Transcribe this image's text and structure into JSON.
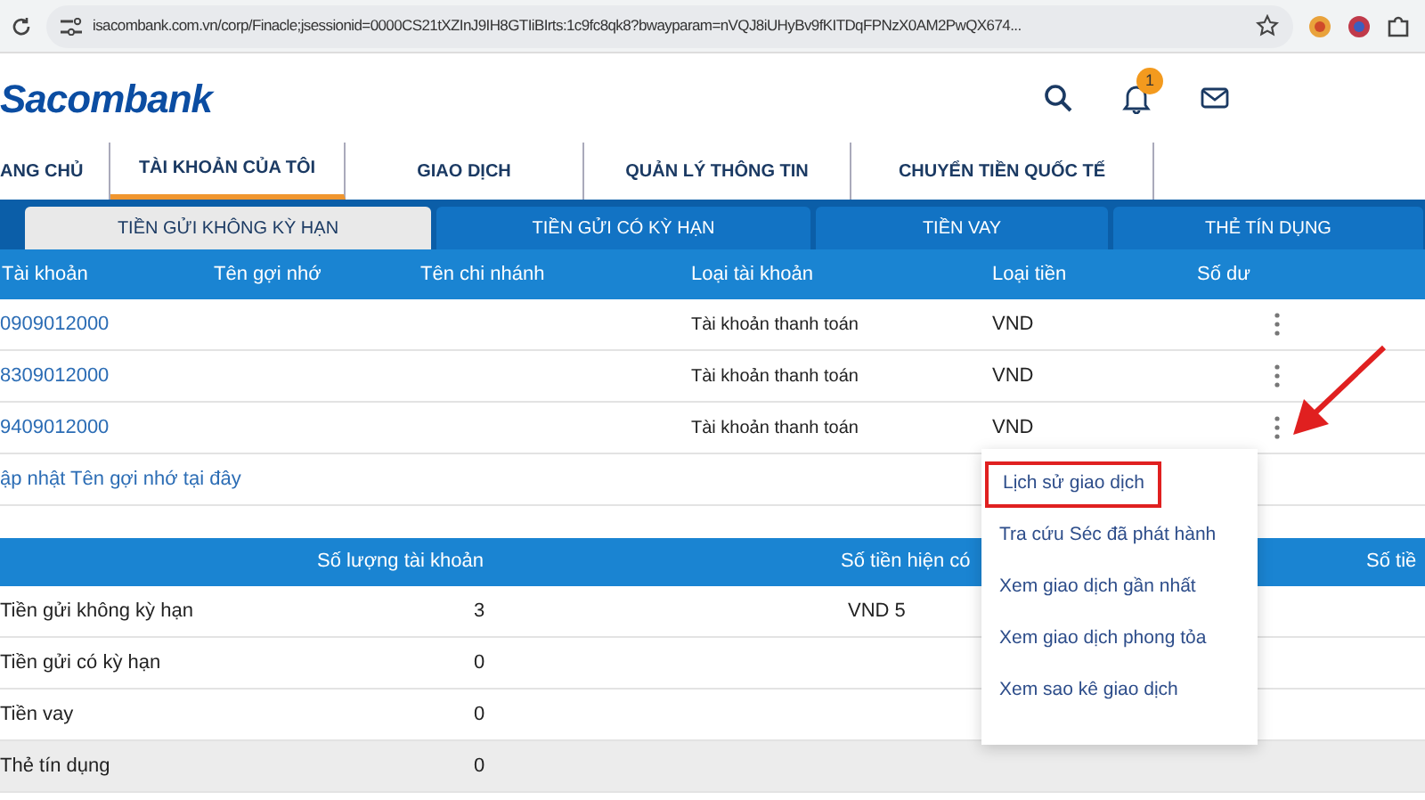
{
  "browser": {
    "url": "isacombank.com.vn/corp/Finacle;jsessionid=0000CS21tXZInJ9IH8GTIiBIrts:1c9fc8qk8?bwayparam=nVQJ8iUHyBv9fKITDqFPNzX0AM2PwQX674..."
  },
  "header": {
    "logo": "Sacombank",
    "notification_count": "1"
  },
  "nav": [
    {
      "label": "ANG CHỦ",
      "selected": false
    },
    {
      "label": "TÀI KHOẢN CỦA TÔI",
      "selected": true
    },
    {
      "label": "GIAO DỊCH",
      "selected": false
    },
    {
      "label": "QUẢN LÝ THÔNG TIN",
      "selected": false
    },
    {
      "label": "CHUYỂN TIỀN QUỐC TẾ",
      "selected": false
    }
  ],
  "tabs": [
    {
      "label": "TIỀN GỬI KHÔNG KỲ HẠN",
      "selected": true
    },
    {
      "label": "TIỀN GỬI CÓ KỲ HẠN",
      "selected": false
    },
    {
      "label": "TIỀN VAY",
      "selected": false
    },
    {
      "label": "THẺ TÍN DỤNG",
      "selected": false
    }
  ],
  "accounts": {
    "columns": [
      "Tài khoản",
      "Tên gợi nhớ",
      "Tên chi nhánh",
      "Loại tài khoản",
      "Loại tiền",
      "Số dư"
    ],
    "rows": [
      {
        "account": "0909012000",
        "type": "Tài khoản thanh toán",
        "currency": "VND"
      },
      {
        "account": "8309012000",
        "type": "Tài khoản thanh toán",
        "currency": "VND"
      },
      {
        "account": "9409012000",
        "type": "Tài khoản thanh toán",
        "currency": "VND"
      }
    ],
    "update_link": "ập nhật Tên gợi nhớ tại đây"
  },
  "menu": {
    "items": [
      {
        "label": "Lịch sử giao dịch",
        "highlighted": true
      },
      {
        "label": "Tra cứu Séc đã phát hành",
        "highlighted": false
      },
      {
        "label": "Xem giao dịch gần nhất",
        "highlighted": false
      },
      {
        "label": "Xem giao dịch phong tỏa",
        "highlighted": false
      },
      {
        "label": "Xem sao kê giao dịch",
        "highlighted": false
      }
    ]
  },
  "summary": {
    "columns": [
      "Số lượng tài khoản",
      "Số tiền hiện có",
      "Số tiề"
    ],
    "rows": [
      {
        "name": "Tiền gửi không kỳ hạn",
        "count": "3",
        "amount": "VND 5",
        "shaded": false
      },
      {
        "name": "Tiền gửi có kỳ hạn",
        "count": "0",
        "shaded": false
      },
      {
        "name": "Tiền vay",
        "count": "0",
        "shaded": false
      },
      {
        "name": "Thẻ tín dụng",
        "count": "0",
        "shaded": true
      }
    ]
  }
}
